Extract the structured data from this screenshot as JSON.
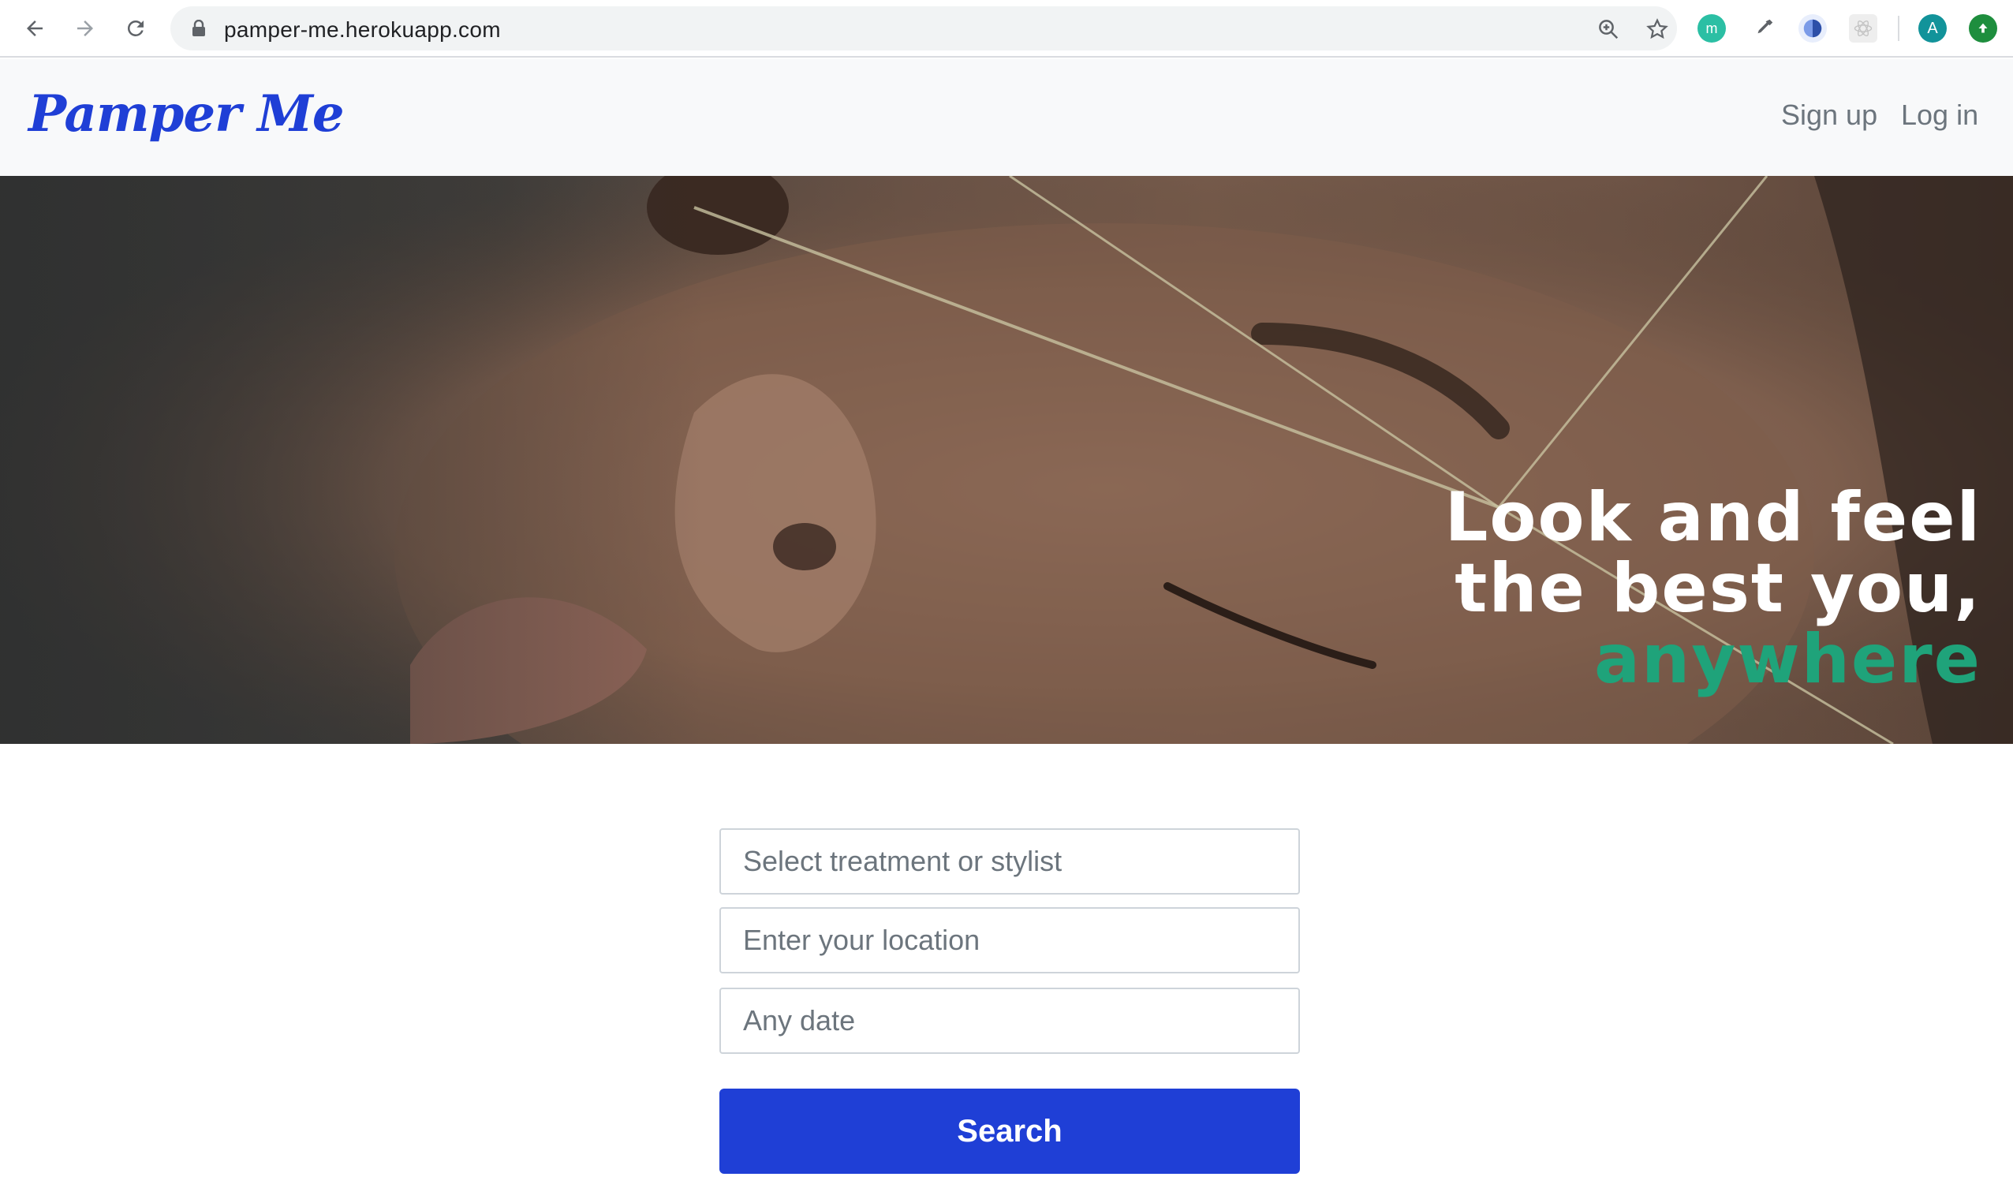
{
  "browser": {
    "url": "pamper-me.herokuapp.com",
    "profile_initial": "A"
  },
  "header": {
    "logo": "Pamper Me",
    "signup_label": "Sign up",
    "login_label": "Log in"
  },
  "hero": {
    "line1": "Look and feel",
    "line2": "the best you,",
    "line3": "anywhere"
  },
  "search": {
    "treatment_placeholder": "Select treatment or stylist",
    "location_placeholder": "Enter your location",
    "date_placeholder": "Any date",
    "button_label": "Search"
  },
  "colors": {
    "brand_blue": "#1f3fd6",
    "accent_green": "#1fa37a"
  }
}
